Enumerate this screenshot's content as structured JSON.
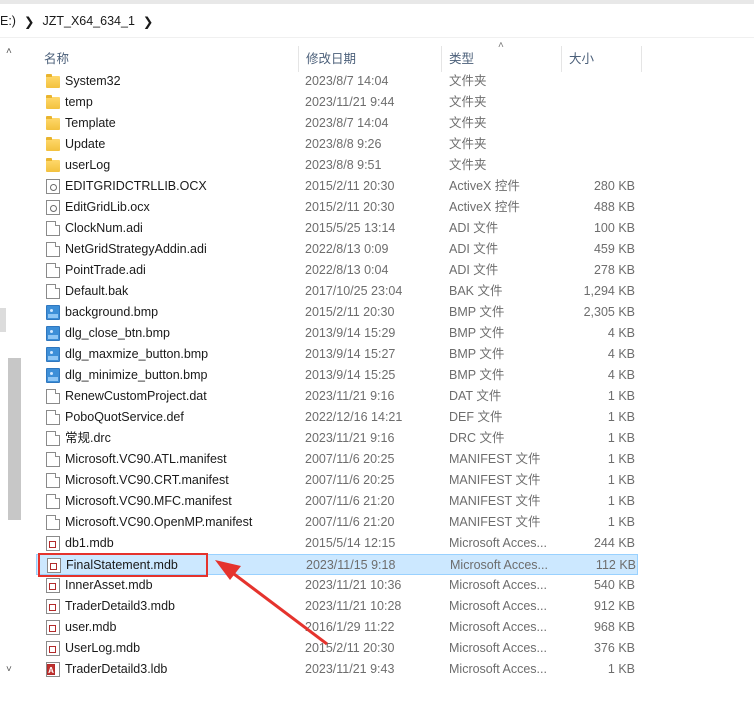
{
  "breadcrumb": {
    "root": "E:)",
    "folder": "JZT_X64_634_1"
  },
  "columns": {
    "name": "名称",
    "date": "修改日期",
    "type": "类型",
    "size": "大小"
  },
  "files": [
    {
      "name": "System32",
      "date": "2023/8/7 14:04",
      "type": "文件夹",
      "size": "",
      "icon": "folder-icon"
    },
    {
      "name": "temp",
      "date": "2023/11/21 9:44",
      "type": "文件夹",
      "size": "",
      "icon": "folder-icon"
    },
    {
      "name": "Template",
      "date": "2023/8/7 14:04",
      "type": "文件夹",
      "size": "",
      "icon": "folder-icon"
    },
    {
      "name": "Update",
      "date": "2023/8/8 9:26",
      "type": "文件夹",
      "size": "",
      "icon": "folder-icon"
    },
    {
      "name": "userLog",
      "date": "2023/8/8 9:51",
      "type": "文件夹",
      "size": "",
      "icon": "folder-icon"
    },
    {
      "name": "EDITGRIDCTRLLIB.OCX",
      "date": "2015/2/11 20:30",
      "type": "ActiveX 控件",
      "size": "280 KB",
      "icon": "activex-icon"
    },
    {
      "name": "EditGridLib.ocx",
      "date": "2015/2/11 20:30",
      "type": "ActiveX 控件",
      "size": "488 KB",
      "icon": "activex-icon"
    },
    {
      "name": "ClockNum.adi",
      "date": "2015/5/25 13:14",
      "type": "ADI 文件",
      "size": "100 KB",
      "icon": "file-icon"
    },
    {
      "name": "NetGridStrategyAddin.adi",
      "date": "2022/8/13 0:09",
      "type": "ADI 文件",
      "size": "459 KB",
      "icon": "file-icon"
    },
    {
      "name": "PointTrade.adi",
      "date": "2022/8/13 0:04",
      "type": "ADI 文件",
      "size": "278 KB",
      "icon": "file-icon"
    },
    {
      "name": "Default.bak",
      "date": "2017/10/25 23:04",
      "type": "BAK 文件",
      "size": "1,294 KB",
      "icon": "file-icon"
    },
    {
      "name": "background.bmp",
      "date": "2015/2/11 20:30",
      "type": "BMP 文件",
      "size": "2,305 KB",
      "icon": "image-icon"
    },
    {
      "name": "dlg_close_btn.bmp",
      "date": "2013/9/14 15:29",
      "type": "BMP 文件",
      "size": "4 KB",
      "icon": "image-icon"
    },
    {
      "name": "dlg_maxmize_button.bmp",
      "date": "2013/9/14 15:27",
      "type": "BMP 文件",
      "size": "4 KB",
      "icon": "image-icon"
    },
    {
      "name": "dlg_minimize_button.bmp",
      "date": "2013/9/14 15:25",
      "type": "BMP 文件",
      "size": "4 KB",
      "icon": "image-icon"
    },
    {
      "name": "RenewCustomProject.dat",
      "date": "2023/11/21 9:16",
      "type": "DAT 文件",
      "size": "1 KB",
      "icon": "file-icon"
    },
    {
      "name": "PoboQuotService.def",
      "date": "2022/12/16 14:21",
      "type": "DEF 文件",
      "size": "1 KB",
      "icon": "file-icon"
    },
    {
      "name": "常规.drc",
      "date": "2023/11/21 9:16",
      "type": "DRC 文件",
      "size": "1 KB",
      "icon": "file-icon"
    },
    {
      "name": "Microsoft.VC90.ATL.manifest",
      "date": "2007/11/6 20:25",
      "type": "MANIFEST 文件",
      "size": "1 KB",
      "icon": "file-icon"
    },
    {
      "name": "Microsoft.VC90.CRT.manifest",
      "date": "2007/11/6 20:25",
      "type": "MANIFEST 文件",
      "size": "1 KB",
      "icon": "file-icon"
    },
    {
      "name": "Microsoft.VC90.MFC.manifest",
      "date": "2007/11/6 21:20",
      "type": "MANIFEST 文件",
      "size": "1 KB",
      "icon": "file-icon"
    },
    {
      "name": "Microsoft.VC90.OpenMP.manifest",
      "date": "2007/11/6 21:20",
      "type": "MANIFEST 文件",
      "size": "1 KB",
      "icon": "file-icon"
    },
    {
      "name": "db1.mdb",
      "date": "2015/5/14 12:15",
      "type": "Microsoft Acces...",
      "size": "244 KB",
      "icon": "access-db-icon"
    },
    {
      "name": "FinalStatement.mdb",
      "date": "2023/11/15 9:18",
      "type": "Microsoft Acces...",
      "size": "112 KB",
      "icon": "access-db-icon",
      "selected": true
    },
    {
      "name": "InnerAsset.mdb",
      "date": "2023/11/21 10:36",
      "type": "Microsoft Acces...",
      "size": "540 KB",
      "icon": "access-db-icon"
    },
    {
      "name": "TraderDetaild3.mdb",
      "date": "2023/11/21 10:28",
      "type": "Microsoft Acces...",
      "size": "912 KB",
      "icon": "access-db-icon"
    },
    {
      "name": "user.mdb",
      "date": "2016/1/29 11:22",
      "type": "Microsoft Acces...",
      "size": "968 KB",
      "icon": "access-db-icon"
    },
    {
      "name": "UserLog.mdb",
      "date": "2015/2/11 20:30",
      "type": "Microsoft Acces...",
      "size": "376 KB",
      "icon": "access-db-icon"
    },
    {
      "name": "TraderDetaild3.ldb",
      "date": "2023/11/21 9:43",
      "type": "Microsoft Acces...",
      "size": "1 KB",
      "icon": "access-lock-icon"
    }
  ],
  "annotation": {
    "color": "#e5332d",
    "target": "FinalStatement.mdb"
  }
}
